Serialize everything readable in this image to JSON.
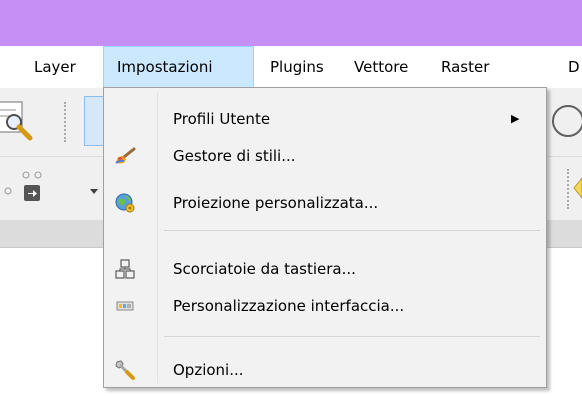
{
  "menubar": {
    "items": [
      "Layer",
      "Impostazioni",
      "Plugins",
      "Vettore",
      "Raster",
      "D"
    ],
    "active": "Impostazioni"
  },
  "dropdown": {
    "items": [
      {
        "label": "Profili Utente",
        "icon": "none",
        "submenu_arrow": "▶"
      },
      {
        "label": "Gestore di stili...",
        "icon": "paintbrush-icon"
      },
      {
        "label": "Proiezione personalizzata...",
        "icon": "globe-gear-icon"
      },
      {
        "label": "Scorciatoie da tastiera...",
        "icon": "keyboard-shortcuts-icon"
      },
      {
        "label": "Personalizzazione interfaccia...",
        "icon": "interface-icon"
      },
      {
        "label": "Opzioni...",
        "icon": "wrench-icon"
      }
    ]
  },
  "colors": {
    "titlebar": "#c58ff5",
    "menu_highlight": "#cce8ff",
    "menu_highlight_border": "#99d1ff"
  }
}
